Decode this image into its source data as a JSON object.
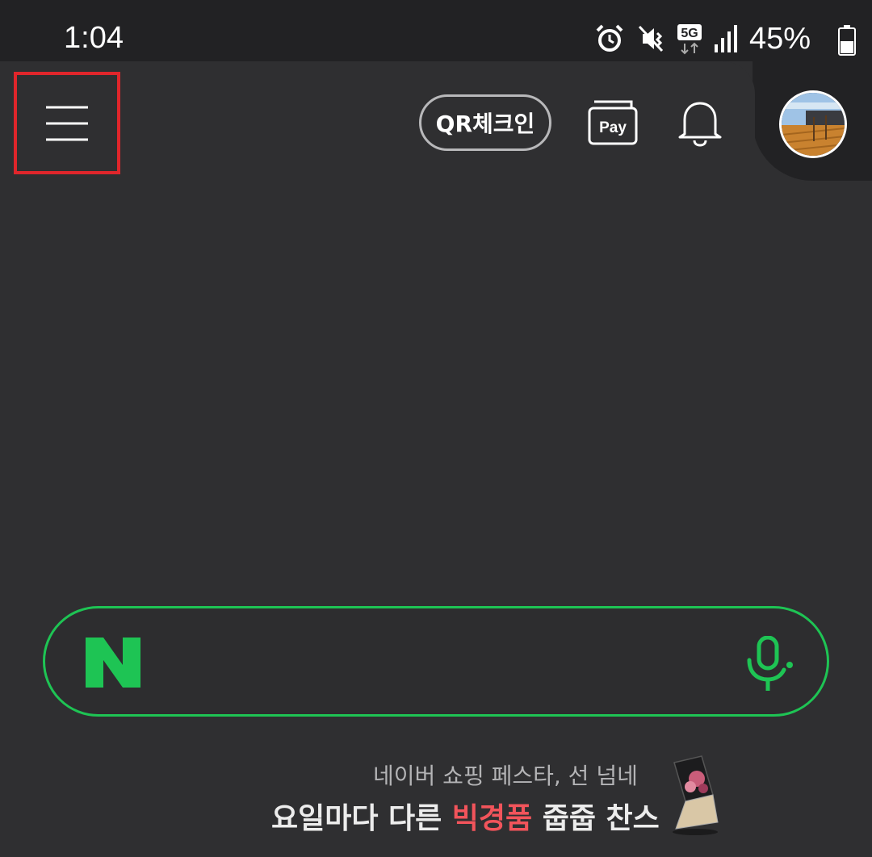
{
  "status_bar": {
    "time": "1:04",
    "network": "5G",
    "battery_percent": "45%",
    "icons": [
      "alarm-icon",
      "vibrate-mute-icon",
      "5g-icon",
      "signal-icon",
      "battery-icon"
    ]
  },
  "header": {
    "qr_checkin_label": "QR체크인",
    "pay_label": "Pay",
    "icons": [
      "menu-icon",
      "pay-icon",
      "bell-icon",
      "avatar"
    ]
  },
  "search": {
    "logo_letter": "N",
    "accent_color": "#1ec454",
    "icons": [
      "naver-logo-icon",
      "microphone-icon"
    ]
  },
  "promo": {
    "subtitle": "네이버 쇼핑 페스타, 선 넘네",
    "title_prefix": "요일마다 다른 ",
    "title_highlight": "빅경품",
    "title_suffix": " 줍줍 찬스",
    "highlight_color": "#f2545b"
  },
  "colors": {
    "background": "#2f2f31",
    "status_bar": "#222224",
    "highlight_box": "#e0262b"
  }
}
